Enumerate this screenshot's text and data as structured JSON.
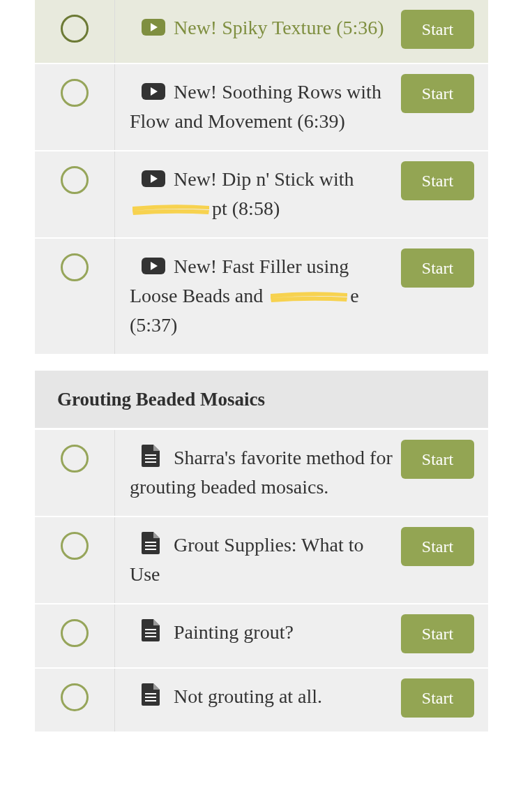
{
  "sections": [
    {
      "items": [
        {
          "kind": "video",
          "highlighted": true,
          "completed": false,
          "segments": [
            {
              "kind": "text",
              "text": "New! Spiky Texture (5:36)"
            }
          ],
          "button": "Start"
        },
        {
          "kind": "video",
          "highlighted": false,
          "completed": false,
          "segments": [
            {
              "kind": "text",
              "text": "New! Soothing Rows with Flow and Movement (6:39)"
            }
          ],
          "button": "Start"
        },
        {
          "kind": "video",
          "highlighted": false,
          "completed": false,
          "segments": [
            {
              "kind": "text",
              "text": "New! Dip n' Stick with "
            },
            {
              "kind": "redaction"
            },
            {
              "kind": "text",
              "text": "pt (8:58)"
            }
          ],
          "button": "Start"
        },
        {
          "kind": "video",
          "highlighted": false,
          "completed": false,
          "segments": [
            {
              "kind": "text",
              "text": "New! Fast Filler using Loose Beads and "
            },
            {
              "kind": "redaction"
            },
            {
              "kind": "text",
              "text": "e (5:37)"
            }
          ],
          "button": "Start"
        }
      ]
    },
    {
      "title": "Grouting Beaded Mosaics",
      "items": [
        {
          "kind": "document",
          "highlighted": false,
          "completed": false,
          "segments": [
            {
              "kind": "text",
              "text": "Sharra's favorite method for grouting beaded mosaics."
            }
          ],
          "button": "Start"
        },
        {
          "kind": "document",
          "highlighted": false,
          "completed": false,
          "segments": [
            {
              "kind": "text",
              "text": "Grout Supplies: What to Use"
            }
          ],
          "button": "Start"
        },
        {
          "kind": "document",
          "highlighted": false,
          "completed": false,
          "segments": [
            {
              "kind": "text",
              "text": "Painting grout?"
            }
          ],
          "button": "Start"
        },
        {
          "kind": "document",
          "highlighted": false,
          "completed": false,
          "segments": [
            {
              "kind": "text",
              "text": "Not grouting at all."
            }
          ],
          "button": "Start"
        }
      ]
    }
  ]
}
